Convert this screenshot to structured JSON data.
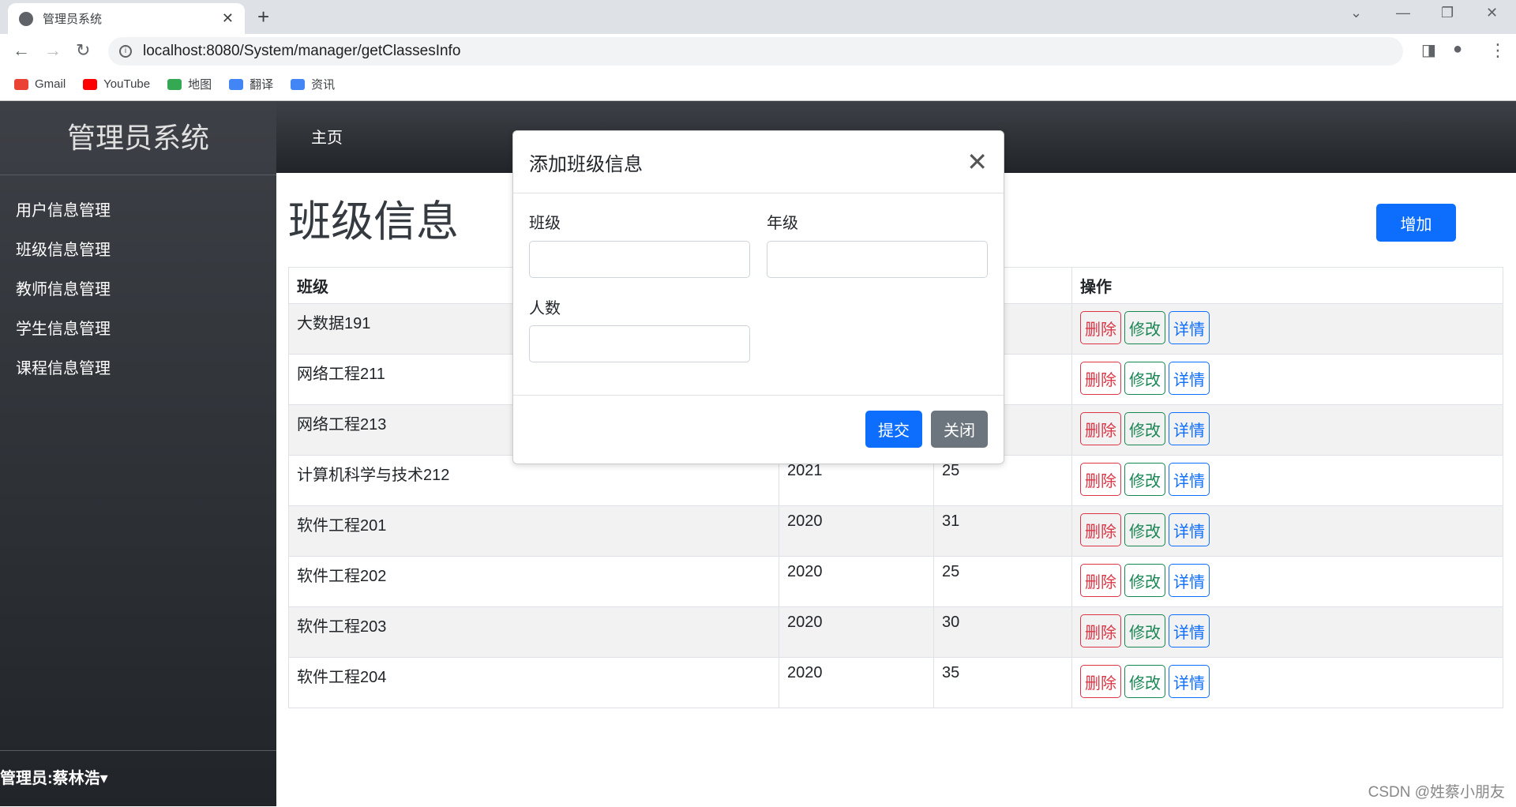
{
  "browser": {
    "tab_title": "管理员系统",
    "url": "localhost:8080/System/manager/getClassesInfo",
    "bookmarks": [
      {
        "label": "Gmail",
        "color": "#ea4335"
      },
      {
        "label": "YouTube",
        "color": "#ff0000"
      },
      {
        "label": "地图",
        "color": "#34a853"
      },
      {
        "label": "翻译",
        "color": "#4285f4"
      },
      {
        "label": "资讯",
        "color": "#4285f4"
      }
    ]
  },
  "sidebar": {
    "brand": "管理员系统",
    "items": [
      {
        "label": "用户信息管理"
      },
      {
        "label": "班级信息管理"
      },
      {
        "label": "教师信息管理"
      },
      {
        "label": "学生信息管理"
      },
      {
        "label": "课程信息管理"
      }
    ],
    "user": "管理员:蔡林浩▾"
  },
  "topnav": {
    "home": "主页"
  },
  "main": {
    "title": "班级信息",
    "add_label": "增加",
    "headers": [
      "班级",
      "",
      "",
      "操作"
    ],
    "rows": [
      [
        "大数据191",
        "",
        ""
      ],
      [
        "网络工程211",
        "",
        ""
      ],
      [
        "网络工程213",
        "",
        ""
      ],
      [
        "计算机科学与技术212",
        "2021",
        "25"
      ],
      [
        "软件工程201",
        "2020",
        "31"
      ],
      [
        "软件工程202",
        "2020",
        "25"
      ],
      [
        "软件工程203",
        "2020",
        "30"
      ],
      [
        "软件工程204",
        "2020",
        "35"
      ]
    ],
    "actions": {
      "delete": "删除",
      "edit": "修改",
      "detail": "详情"
    }
  },
  "modal": {
    "title": "添加班级信息",
    "close": "✕",
    "fields": {
      "class": "班级",
      "grade": "年级",
      "count": "人数"
    },
    "submit": "提交",
    "cancel": "关闭"
  },
  "colors": {
    "primary": "#0d6efd",
    "danger": "#dc3545",
    "success": "#198754",
    "secondary": "#6c757d"
  },
  "watermark": "CSDN @姓蔡小朋友"
}
